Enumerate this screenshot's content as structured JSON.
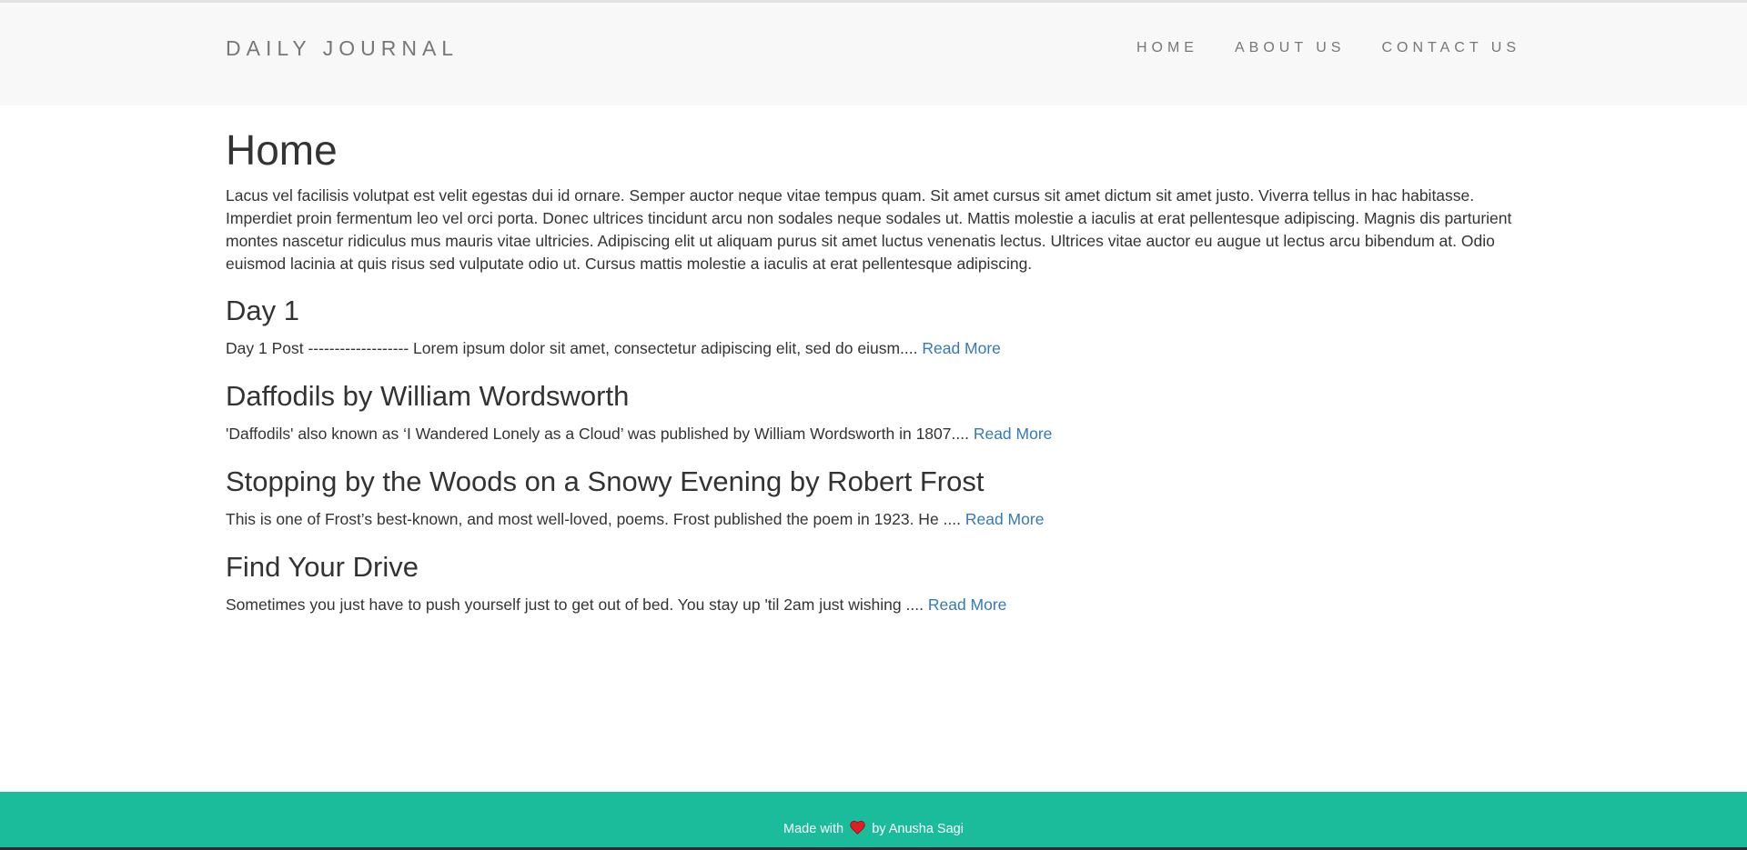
{
  "navbar": {
    "brand": "DAILY JOURNAL",
    "links": [
      "HOME",
      "ABOUT US",
      "CONTACT US"
    ]
  },
  "main": {
    "title": "Home",
    "intro": "Lacus vel facilisis volutpat est velit egestas dui id ornare. Semper auctor neque vitae tempus quam. Sit amet cursus sit amet dictum sit amet justo. Viverra tellus in hac habitasse. Imperdiet proin fermentum leo vel orci porta. Donec ultrices tincidunt arcu non sodales neque sodales ut. Mattis molestie a iaculis at erat pellentesque adipiscing. Magnis dis parturient montes nascetur ridiculus mus mauris vitae ultricies. Adipiscing elit ut aliquam purus sit amet luctus venenatis lectus. Ultrices vitae auctor eu augue ut lectus arcu bibendum at. Odio euismod lacinia at quis risus sed vulputate odio ut. Cursus mattis molestie a iaculis at erat pellentesque adipiscing.",
    "posts": [
      {
        "title": "Day 1",
        "excerpt": "Day 1 Post ------------------- Lorem ipsum dolor sit amet, consectetur adipiscing elit, sed do eiusm....",
        "read_more": "Read More"
      },
      {
        "title": "Daffodils by William Wordsworth",
        "excerpt": "'Daffodils' also known as ‘I Wandered Lonely as a Cloud’ was published by William Wordsworth in 1807....",
        "read_more": "Read More"
      },
      {
        "title": "Stopping by the Woods on a Snowy Evening by Robert Frost",
        "excerpt": "This is one of Frost’s best-known, and most well-loved, poems. Frost published the poem in 1923. He ....",
        "read_more": "Read More"
      },
      {
        "title": "Find Your Drive",
        "excerpt": "Sometimes you just have to push yourself just to get out of bed. You stay up 'til 2am just wishing ....",
        "read_more": "Read More"
      }
    ]
  },
  "footer": {
    "made_with": "Made with",
    "by": "by Anusha Sagi",
    "icon": "heart-icon",
    "accent_color": "#1abc9c",
    "heart_color": "#e31b23"
  },
  "colors": {
    "link": "#337ab7",
    "nav_bg": "#f8f8f8",
    "nav_text": "#777777",
    "body_text": "#333333"
  }
}
